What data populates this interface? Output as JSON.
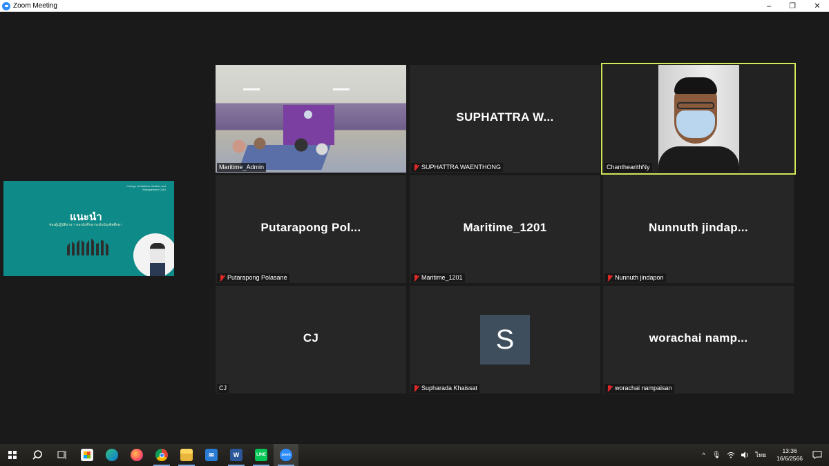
{
  "window": {
    "title": "Zoom Meeting",
    "minimize": "–",
    "restore": "❐",
    "close": "✕"
  },
  "share": {
    "heading": "แนะนำ",
    "subtitle": "ช่องผู้ปฏิบัติงาน ฯ ของนักศึกษาระดับบัณฑิตศึกษา",
    "corner_text": "College of Maritime Studies and Management CMU"
  },
  "participants": [
    {
      "label": "Maritime_Admin",
      "muted": false,
      "video": "room"
    },
    {
      "display": "SUPHATTRA  W...",
      "label": "SUPHATTRA WAENTHONG",
      "muted": true
    },
    {
      "label": "ChanthearithNy",
      "muted": false,
      "video": "cam",
      "active": true
    },
    {
      "display": "Putarapong  Pol...",
      "label": "Putarapong Polasane",
      "muted": true
    },
    {
      "display": "Maritime_1201",
      "label": "Maritime_1201",
      "muted": true
    },
    {
      "display": "Nunnuth  jindap...",
      "label": "Nunnuth jindapon",
      "muted": true
    },
    {
      "display": "CJ",
      "label": "CJ",
      "muted": false
    },
    {
      "avatar": "S",
      "label": "Supharada Khaissat",
      "muted": true
    },
    {
      "display": "worachai  namp...",
      "label": "worachai nampaisan",
      "muted": true
    }
  ],
  "taskbar": {
    "apps": [
      "start",
      "search",
      "task-view",
      "store",
      "edge",
      "firefox",
      "chrome",
      "file-explorer",
      "mail",
      "word",
      "line",
      "zoom"
    ],
    "tray": {
      "chevron": "^",
      "lang": "ไทย",
      "time": "13:36",
      "date": "16/6/2566"
    }
  }
}
